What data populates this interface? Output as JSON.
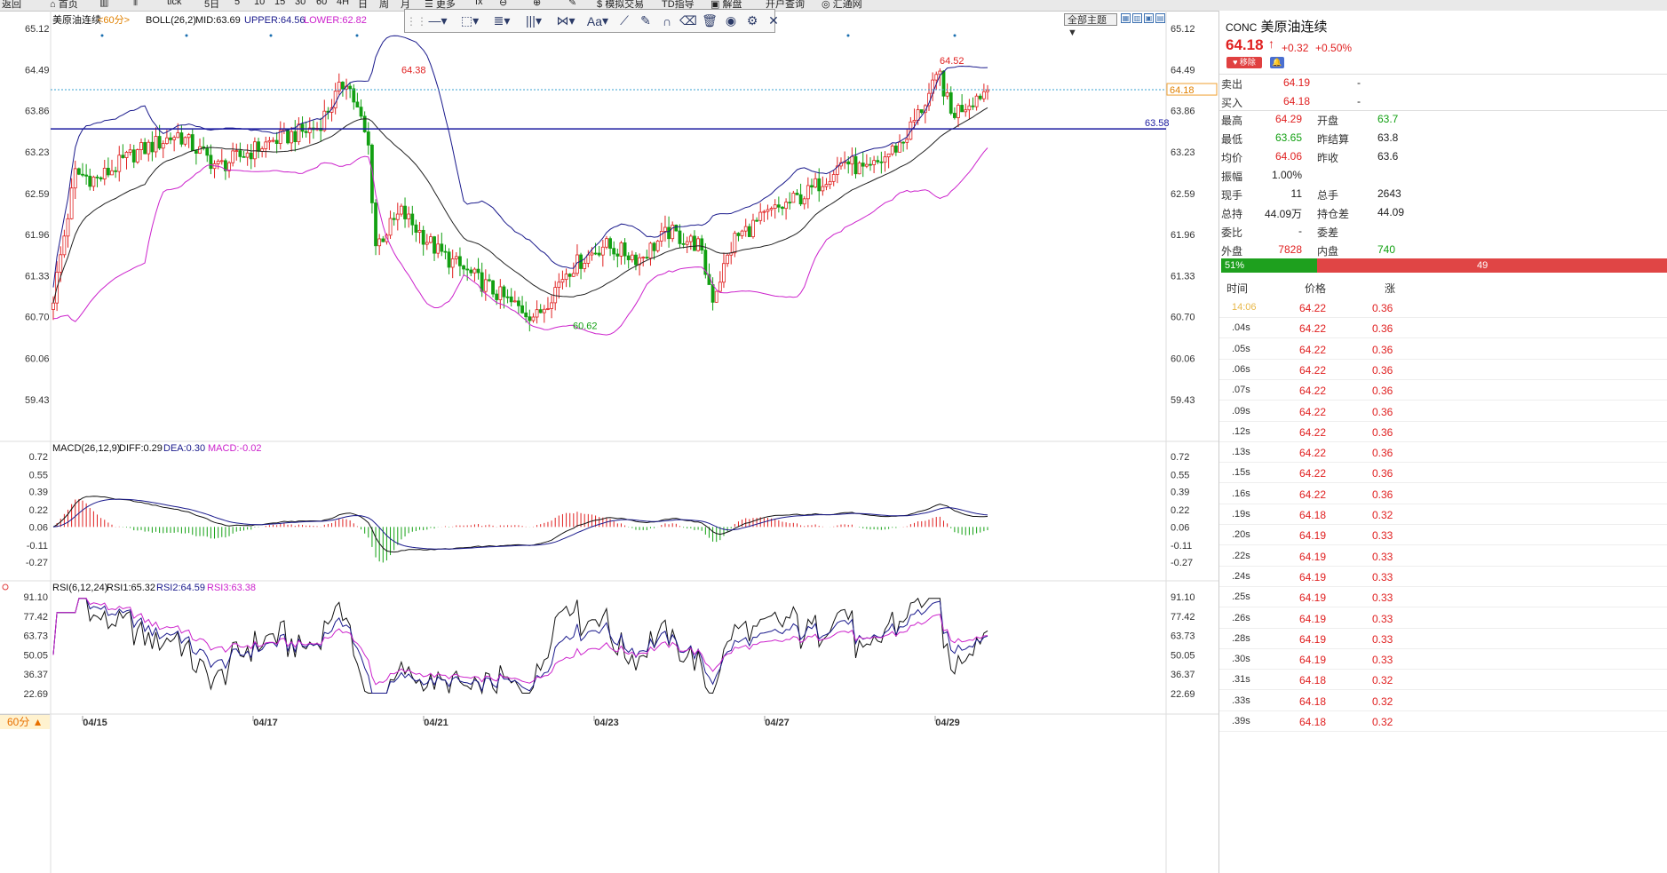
{
  "topbar": {
    "items": [
      "返回",
      "首页",
      "",
      "",
      "tick",
      "5日",
      "5",
      "10",
      "15",
      "30",
      "60",
      "4H",
      "日",
      "周",
      "月",
      "更多",
      "",
      "",
      "",
      "模拟交易",
      "TD指导",
      "解盘",
      "开户查询",
      "汇通网"
    ]
  },
  "chart": {
    "title": "美原油连续",
    "period_tag": "<60分>",
    "boll_label": "BOLL(26,2)",
    "mid_label": "MID:63.69",
    "upper_label": "UPPER:64.56",
    "lower_label": "LOWER:62.82",
    "y_ticks": [
      "65.12",
      "64.49",
      "63.86",
      "63.23",
      "62.59",
      "61.96",
      "61.33",
      "60.70",
      "60.06",
      "59.43"
    ],
    "hline_label": "63.58",
    "last_price_tag": "64.18",
    "annot_high1": "64.38",
    "annot_high2": "64.52",
    "annot_low": "60.62",
    "dates": [
      "04/15",
      "04/17",
      "04/21",
      "04/23",
      "04/27",
      "04/29"
    ],
    "period_button": "60分 ▲",
    "theme_button": "全部主题 ▼"
  },
  "macd": {
    "label": "MACD(26,12,9)",
    "diff": "DIFF:0.29",
    "dea": "DEA:0.30",
    "macd": "MACD:-0.02",
    "y_ticks": [
      "0.72",
      "0.55",
      "0.39",
      "0.22",
      "0.06",
      "-0.11",
      "-0.27"
    ]
  },
  "rsi": {
    "label": "RSI(6,12,24)",
    "rsi1": "RSI1:65.32",
    "rsi2": "RSI2:64.59",
    "rsi3": "RSI3:63.38",
    "y_ticks": [
      "91.10",
      "77.42",
      "63.73",
      "50.05",
      "36.37",
      "22.69"
    ]
  },
  "toolbar": {
    "tools": [
      "grip",
      "line-tool",
      "rect-tool",
      "fib-tool",
      "bars-tool",
      "pattern-tool",
      "text-tool",
      "pencil-tool",
      "brush-tool",
      "magnet-tool",
      "eraser-tool",
      "trash-tool",
      "eye-tool",
      "settings-tool",
      "close-tool"
    ],
    "text_tool_label": "Aa"
  },
  "quote": {
    "code": "CONC",
    "name": "美原油连续",
    "price": "64.18",
    "change": "+0.32",
    "change_pct": "+0.50%",
    "fav_label": "♥ 移除",
    "sell_label": "卖出",
    "sell_price": "64.19",
    "sell_vol": "-",
    "buy_label": "买入",
    "buy_price": "64.18",
    "buy_vol": "-",
    "rows": [
      {
        "l1": "最高",
        "v1": "64.29",
        "c1": "red",
        "l2": "开盘",
        "v2": "63.7",
        "c2": "green"
      },
      {
        "l1": "最低",
        "v1": "63.65",
        "c1": "green",
        "l2": "昨结算",
        "v2": "63.8",
        "c2": "black"
      },
      {
        "l1": "均价",
        "v1": "64.06",
        "c1": "red",
        "l2": "昨收",
        "v2": "63.6",
        "c2": "black"
      },
      {
        "l1": "振幅",
        "v1": "1.00%",
        "c1": "black",
        "l2": "",
        "v2": "",
        "c2": "black"
      },
      {
        "l1": "现手",
        "v1": "11",
        "c1": "black",
        "l2": "总手",
        "v2": "2643",
        "c2": "black"
      },
      {
        "l1": "总持",
        "v1": "44.09万",
        "c1": "black",
        "l2": "持仓差",
        "v2": "44.09",
        "c2": "black"
      },
      {
        "l1": "委比",
        "v1": "-",
        "c1": "black",
        "l2": "委差",
        "v2": "",
        "c2": "black"
      },
      {
        "l1": "外盘",
        "v1": "7828",
        "c1": "red",
        "l2": "内盘",
        "v2": "740",
        "c2": "green"
      }
    ],
    "buy_ratio": "51%",
    "sell_ratio": "49",
    "ticks_head": {
      "time": "时间",
      "price": "价格",
      "chg": "涨"
    }
  },
  "ticks": [
    {
      "t": "14:06",
      "p": "64.22",
      "v": "0.36",
      "first": true
    },
    {
      "t": ".04s",
      "p": "64.22",
      "v": "0.36"
    },
    {
      "t": ".05s",
      "p": "64.22",
      "v": "0.36"
    },
    {
      "t": ".06s",
      "p": "64.22",
      "v": "0.36"
    },
    {
      "t": ".07s",
      "p": "64.22",
      "v": "0.36"
    },
    {
      "t": ".09s",
      "p": "64.22",
      "v": "0.36"
    },
    {
      "t": ".12s",
      "p": "64.22",
      "v": "0.36"
    },
    {
      "t": ".13s",
      "p": "64.22",
      "v": "0.36"
    },
    {
      "t": ".15s",
      "p": "64.22",
      "v": "0.36"
    },
    {
      "t": ".16s",
      "p": "64.22",
      "v": "0.36"
    },
    {
      "t": ".19s",
      "p": "64.18",
      "v": "0.32"
    },
    {
      "t": ".20s",
      "p": "64.19",
      "v": "0.33"
    },
    {
      "t": ".22s",
      "p": "64.19",
      "v": "0.33"
    },
    {
      "t": ".24s",
      "p": "64.19",
      "v": "0.33"
    },
    {
      "t": ".25s",
      "p": "64.19",
      "v": "0.33"
    },
    {
      "t": ".26s",
      "p": "64.19",
      "v": "0.33"
    },
    {
      "t": ".28s",
      "p": "64.19",
      "v": "0.33"
    },
    {
      "t": ".30s",
      "p": "64.19",
      "v": "0.33"
    },
    {
      "t": ".31s",
      "p": "64.18",
      "v": "0.32"
    },
    {
      "t": ".33s",
      "p": "64.18",
      "v": "0.32"
    },
    {
      "t": ".39s",
      "p": "64.18",
      "v": "0.32"
    }
  ],
  "colors": {
    "up": "#e02020",
    "down": "#12a012",
    "boll_mid": "#222222",
    "boll_upper": "#1a1a8c",
    "boll_lower": "#cc22cc",
    "hline": "#1a1aa0"
  }
}
